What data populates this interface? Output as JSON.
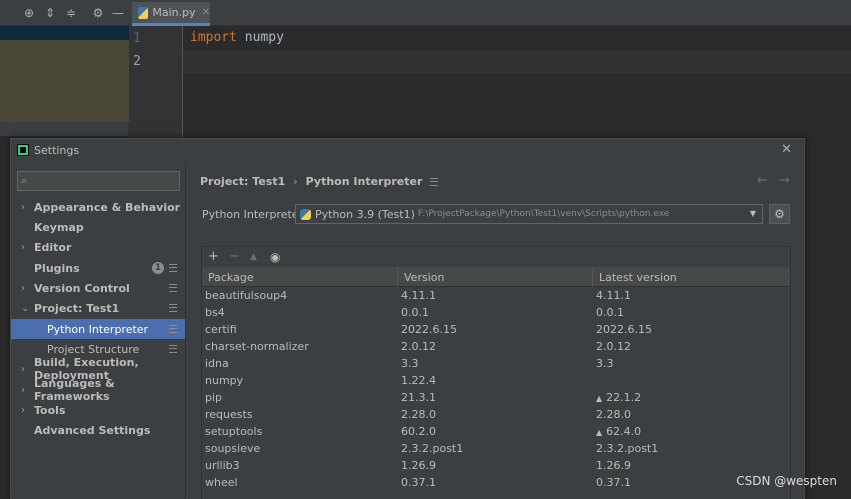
{
  "editor": {
    "tab_label": "Main.py",
    "line_numbers": [
      "1",
      "2"
    ],
    "code_keyword": "import",
    "code_rest": " numpy"
  },
  "dialog": {
    "title": "Settings",
    "breadcrumb": {
      "parent": "Project: Test1",
      "separator": "›",
      "current": "Python Interpreter"
    }
  },
  "sidebar": {
    "items": [
      {
        "label": "Appearance & Behavior"
      },
      {
        "label": "Keymap"
      },
      {
        "label": "Editor"
      },
      {
        "label": "Plugins",
        "badge": "1"
      },
      {
        "label": "Version Control"
      },
      {
        "label": "Project: Test1"
      },
      {
        "label": "Python Interpreter"
      },
      {
        "label": "Project Structure"
      },
      {
        "label": "Build, Execution, Deployment"
      },
      {
        "label": "Languages & Frameworks"
      },
      {
        "label": "Tools"
      },
      {
        "label": "Advanced Settings"
      }
    ]
  },
  "interpreter": {
    "label": "Python Interpreter:",
    "selected_name": "Python 3.9 (Test1)",
    "selected_path": "F:\\ProjectPackage\\Python\\Test1\\venv\\Scripts\\python.exe"
  },
  "packages": {
    "columns": [
      "Package",
      "Version",
      "Latest version"
    ],
    "rows": [
      {
        "name": "beautifulsoup4",
        "version": "4.11.1",
        "latest": "4.11.1",
        "upgrade": false
      },
      {
        "name": "bs4",
        "version": "0.0.1",
        "latest": "0.0.1",
        "upgrade": false
      },
      {
        "name": "certifi",
        "version": "2022.6.15",
        "latest": "2022.6.15",
        "upgrade": false
      },
      {
        "name": "charset-normalizer",
        "version": "2.0.12",
        "latest": "2.0.12",
        "upgrade": false
      },
      {
        "name": "idna",
        "version": "3.3",
        "latest": "3.3",
        "upgrade": false
      },
      {
        "name": "numpy",
        "version": "1.22.4",
        "latest": "",
        "upgrade": false
      },
      {
        "name": "pip",
        "version": "21.3.1",
        "latest": "22.1.2",
        "upgrade": true
      },
      {
        "name": "requests",
        "version": "2.28.0",
        "latest": "2.28.0",
        "upgrade": false
      },
      {
        "name": "setuptools",
        "version": "60.2.0",
        "latest": "62.4.0",
        "upgrade": true
      },
      {
        "name": "soupsieve",
        "version": "2.3.2.post1",
        "latest": "2.3.2.post1",
        "upgrade": false
      },
      {
        "name": "urllib3",
        "version": "1.26.9",
        "latest": "1.26.9",
        "upgrade": false
      },
      {
        "name": "wheel",
        "version": "0.37.1",
        "latest": "0.37.1",
        "upgrade": false
      }
    ]
  },
  "watermark": "CSDN @wespten",
  "icons": {
    "toolbar": [
      "crosshair-icon",
      "expand-all-icon",
      "collapse-all-icon",
      "gear-icon",
      "minimize-icon"
    ],
    "package_toolbar": [
      "add-icon",
      "remove-icon",
      "upgrade-icon",
      "eye-icon"
    ]
  },
  "colors": {
    "selection": "#4b6eaf",
    "tab_underline": "#4a88c7",
    "keyword": "#cc7832"
  }
}
